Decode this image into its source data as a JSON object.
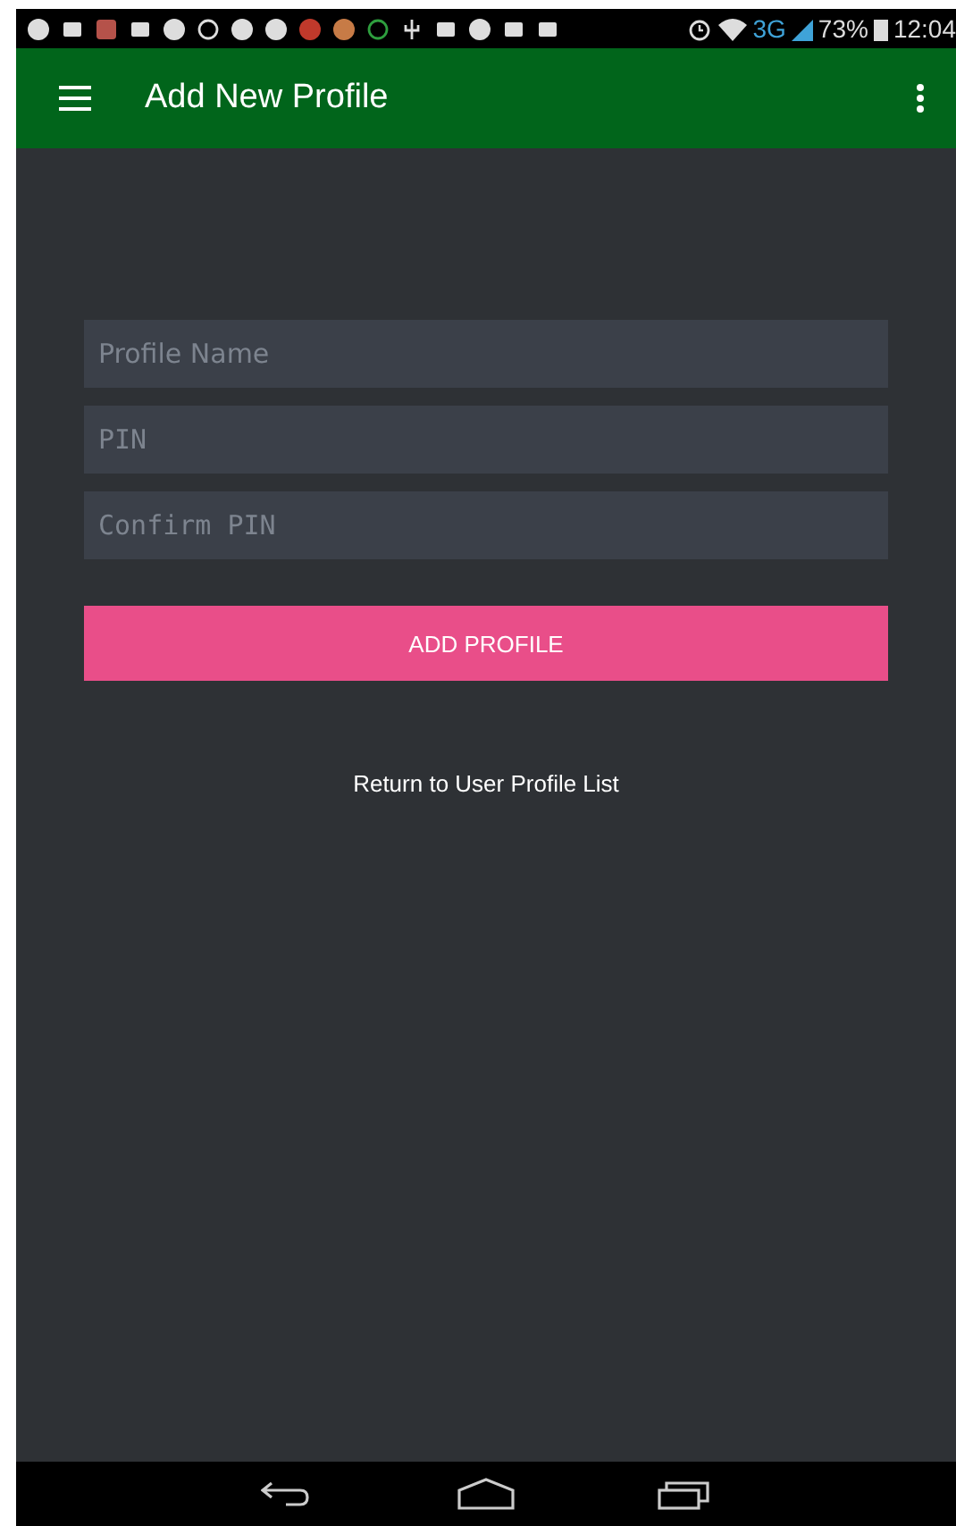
{
  "status_bar": {
    "network": "3G",
    "battery": "73%",
    "time": "12:04"
  },
  "app_bar": {
    "title": "Add New Profile"
  },
  "fields": [
    {
      "placeholder": "Profile Name",
      "kind": "text"
    },
    {
      "placeholder": "PIN",
      "kind": "password"
    },
    {
      "placeholder": "Confirm PIN",
      "kind": "password"
    }
  ],
  "submit_button": "ADD PROFILE",
  "link": "Return to User Profile List"
}
